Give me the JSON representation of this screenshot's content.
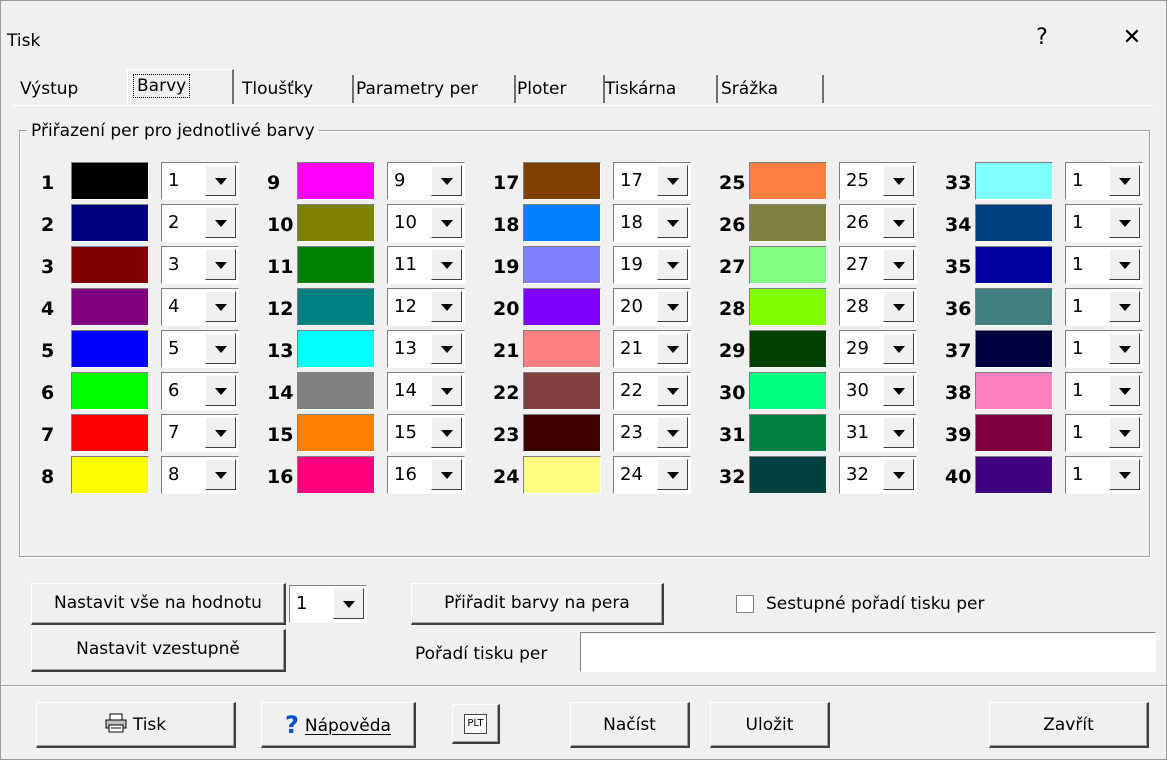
{
  "window": {
    "title": "Tisk",
    "help_glyph": "?",
    "close_glyph": "✕"
  },
  "tabs": [
    {
      "label": "Výstup"
    },
    {
      "label": "Barvy"
    },
    {
      "label": "Tloušťky"
    },
    {
      "label": "Parametry per"
    },
    {
      "label": "Ploter"
    },
    {
      "label": "Tiskárna"
    },
    {
      "label": "Srážka"
    }
  ],
  "active_tab": "Barvy",
  "group_title": "Přiřazení per pro jednotlivé barvy",
  "colors": [
    {
      "n": "1",
      "color": "#000000",
      "pen": "1"
    },
    {
      "n": "2",
      "color": "#000080",
      "pen": "2"
    },
    {
      "n": "3",
      "color": "#800000",
      "pen": "3"
    },
    {
      "n": "4",
      "color": "#800080",
      "pen": "4"
    },
    {
      "n": "5",
      "color": "#0000ff",
      "pen": "5"
    },
    {
      "n": "6",
      "color": "#00ff00",
      "pen": "6"
    },
    {
      "n": "7",
      "color": "#ff0000",
      "pen": "7"
    },
    {
      "n": "8",
      "color": "#ffff00",
      "pen": "8"
    },
    {
      "n": "9",
      "color": "#ff00ff",
      "pen": "9"
    },
    {
      "n": "10",
      "color": "#808000",
      "pen": "10"
    },
    {
      "n": "11",
      "color": "#008000",
      "pen": "11"
    },
    {
      "n": "12",
      "color": "#008080",
      "pen": "12"
    },
    {
      "n": "13",
      "color": "#00ffff",
      "pen": "13"
    },
    {
      "n": "14",
      "color": "#808080",
      "pen": "14"
    },
    {
      "n": "15",
      "color": "#ff8000",
      "pen": "15"
    },
    {
      "n": "16",
      "color": "#ff0080",
      "pen": "16"
    },
    {
      "n": "17",
      "color": "#804000",
      "pen": "17"
    },
    {
      "n": "18",
      "color": "#0080ff",
      "pen": "18"
    },
    {
      "n": "19",
      "color": "#8080ff",
      "pen": "19"
    },
    {
      "n": "20",
      "color": "#8000ff",
      "pen": "20"
    },
    {
      "n": "21",
      "color": "#ff8080",
      "pen": "21"
    },
    {
      "n": "22",
      "color": "#804040",
      "pen": "22"
    },
    {
      "n": "23",
      "color": "#400000",
      "pen": "23"
    },
    {
      "n": "24",
      "color": "#ffff80",
      "pen": "24"
    },
    {
      "n": "25",
      "color": "#ff8040",
      "pen": "25"
    },
    {
      "n": "26",
      "color": "#808040",
      "pen": "26"
    },
    {
      "n": "27",
      "color": "#80ff80",
      "pen": "27"
    },
    {
      "n": "28",
      "color": "#80ff00",
      "pen": "28"
    },
    {
      "n": "29",
      "color": "#004000",
      "pen": "29"
    },
    {
      "n": "30",
      "color": "#00ff80",
      "pen": "30"
    },
    {
      "n": "31",
      "color": "#008040",
      "pen": "31"
    },
    {
      "n": "32",
      "color": "#004040",
      "pen": "32"
    },
    {
      "n": "33",
      "color": "#80ffff",
      "pen": "1"
    },
    {
      "n": "34",
      "color": "#004080",
      "pen": "1"
    },
    {
      "n": "35",
      "color": "#0000a0",
      "pen": "1"
    },
    {
      "n": "36",
      "color": "#408080",
      "pen": "1"
    },
    {
      "n": "37",
      "color": "#000040",
      "pen": "1"
    },
    {
      "n": "38",
      "color": "#ff80c0",
      "pen": "1"
    },
    {
      "n": "39",
      "color": "#800040",
      "pen": "1"
    },
    {
      "n": "40",
      "color": "#400080",
      "pen": "1"
    }
  ],
  "controls": {
    "set_all_label": "Nastavit vše na hodnotu",
    "set_all_value": "1",
    "assign_colors_label": "Přiřadit barvy na pera",
    "descending_label": "Sestupné pořadí tisku per",
    "set_ascending_label": "Nastavit vzestupně",
    "print_order_label": "Pořadí tisku per",
    "print_order_value": ""
  },
  "footer": {
    "print_label": "Tisk",
    "help_label": "Nápověda",
    "plt_icon_text": "PLT",
    "load_label": "Načíst",
    "save_label": "Uložit",
    "close_label": "Zavřít"
  }
}
